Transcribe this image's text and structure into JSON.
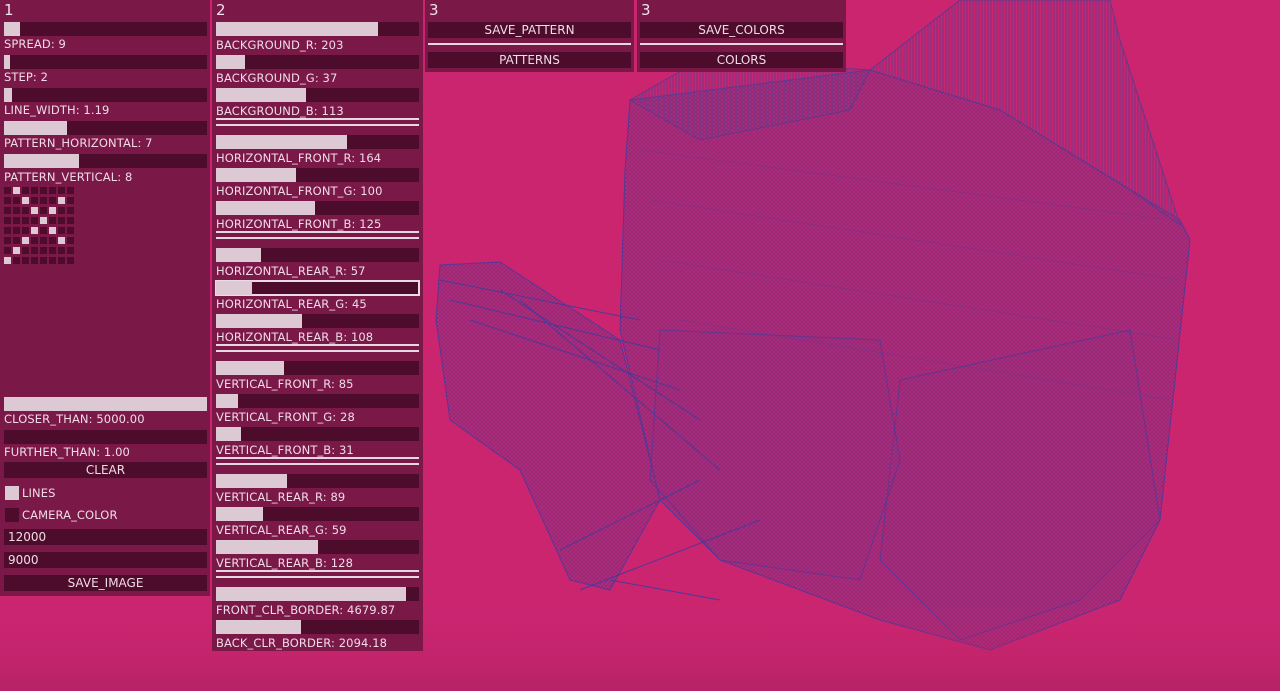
{
  "colors": {
    "background": "#cb2570",
    "panel": "#7a1848",
    "track": "#4e0c2c",
    "fill": "#dcc9d4"
  },
  "panel1": {
    "number": "1",
    "sliders": [
      {
        "label": "",
        "level": 0.08
      },
      {
        "label": "SPREAD: 9",
        "level": 0.03
      },
      {
        "label": "STEP: 2",
        "level": 0.04
      },
      {
        "label": "LINE_WIDTH: 1.19",
        "level": 0.31
      },
      {
        "label": "PATTERN_HORIZONTAL: 7",
        "level": 0.37
      }
    ],
    "pattern_vertical_label": "PATTERN_VERTICAL: 8",
    "pattern_grid": [
      [
        0,
        1,
        0,
        0,
        0,
        0,
        0,
        0
      ],
      [
        0,
        0,
        1,
        0,
        0,
        0,
        1,
        0
      ],
      [
        0,
        0,
        0,
        1,
        0,
        1,
        0,
        0
      ],
      [
        0,
        0,
        0,
        0,
        1,
        0,
        0,
        0
      ],
      [
        0,
        0,
        0,
        1,
        0,
        1,
        0,
        0
      ],
      [
        0,
        0,
        1,
        0,
        0,
        0,
        1,
        0
      ],
      [
        0,
        1,
        0,
        0,
        0,
        0,
        0,
        0
      ],
      [
        1,
        0,
        0,
        0,
        0,
        0,
        0,
        0
      ]
    ],
    "closer_label": "CLOSER_THAN: 5000.00",
    "closer_level": 1.0,
    "further_label": "FURTHER_THAN: 1.00",
    "further_level": 0.0,
    "clear_label": "CLEAR",
    "lines_label": "LINES",
    "lines_on": true,
    "camera_label": "CAMERA_COLOR",
    "camera_on": false,
    "field1": "12000",
    "field2": "9000",
    "save_image_label": "SAVE_IMAGE"
  },
  "panel2": {
    "number": "2",
    "groups": [
      [
        {
          "label": "BACKGROUND_R: 203",
          "level": 0.796
        },
        {
          "label": "BACKGROUND_G: 37",
          "level": 0.145
        },
        {
          "label": "BACKGROUND_B: 113",
          "level": 0.443
        }
      ],
      [
        {
          "label": "HORIZONTAL_FRONT_R: 164",
          "level": 0.643
        },
        {
          "label": "HORIZONTAL_FRONT_G: 100",
          "level": 0.392
        },
        {
          "label": "HORIZONTAL_FRONT_B: 125",
          "level": 0.49
        }
      ],
      [
        {
          "label": "HORIZONTAL_REAR_R: 57",
          "level": 0.224
        },
        {
          "label": "HORIZONTAL_REAR_G: 45",
          "level": 0.176
        },
        {
          "label": "HORIZONTAL_REAR_B: 108",
          "level": 0.424
        }
      ],
      [
        {
          "label": "VERTICAL_FRONT_R: 85",
          "level": 0.333
        },
        {
          "label": "VERTICAL_FRONT_G: 28",
          "level": 0.11
        },
        {
          "label": "VERTICAL_FRONT_B: 31",
          "level": 0.122
        }
      ],
      [
        {
          "label": "VERTICAL_REAR_R: 89",
          "level": 0.349
        },
        {
          "label": "VERTICAL_REAR_G: 59",
          "level": 0.231
        },
        {
          "label": "VERTICAL_REAR_B: 128",
          "level": 0.502
        }
      ],
      [
        {
          "label": "FRONT_CLR_BORDER: 4679.87",
          "level": 0.936
        },
        {
          "label": "BACK_CLR_BORDER: 2094.18",
          "level": 0.419
        }
      ]
    ]
  },
  "panel3": {
    "number": "3",
    "save_label": "SAVE_PATTERN",
    "list_label": "PATTERNS"
  },
  "panel4": {
    "number": "3",
    "save_label": "SAVE_COLORS",
    "list_label": "COLORS"
  }
}
